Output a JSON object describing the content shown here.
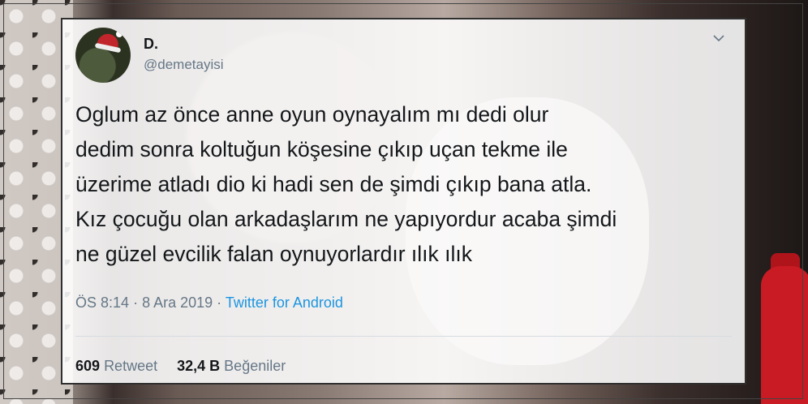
{
  "tweet": {
    "display_name": "D.",
    "handle": "@demetayisi",
    "text_lines": [
      "Oglum az önce anne oyun oynayalım mı dedi olur",
      "dedim sonra koltuğun köşesine çıkıp uçan tekme ile",
      "üzerime atladı dio ki hadi sen de şimdi çıkıp bana atla.",
      "Kız çocuğu olan arkadaşlarım ne yapıyordur acaba şimdi",
      "ne güzel evcilik falan oynuyorlardır ılık ılık"
    ],
    "time": "ÖS 8:14",
    "date": "8 Ara 2019",
    "separator": "·",
    "source": "Twitter for Android",
    "retweet_count": "609",
    "retweet_label": "Retweet",
    "like_count": "32,4 B",
    "like_label": "Beğeniler",
    "menu_icon": "chevron-down-icon",
    "colors": {
      "link": "#1b95e0",
      "secondary_text": "#657786",
      "primary_text": "#14171a"
    }
  }
}
